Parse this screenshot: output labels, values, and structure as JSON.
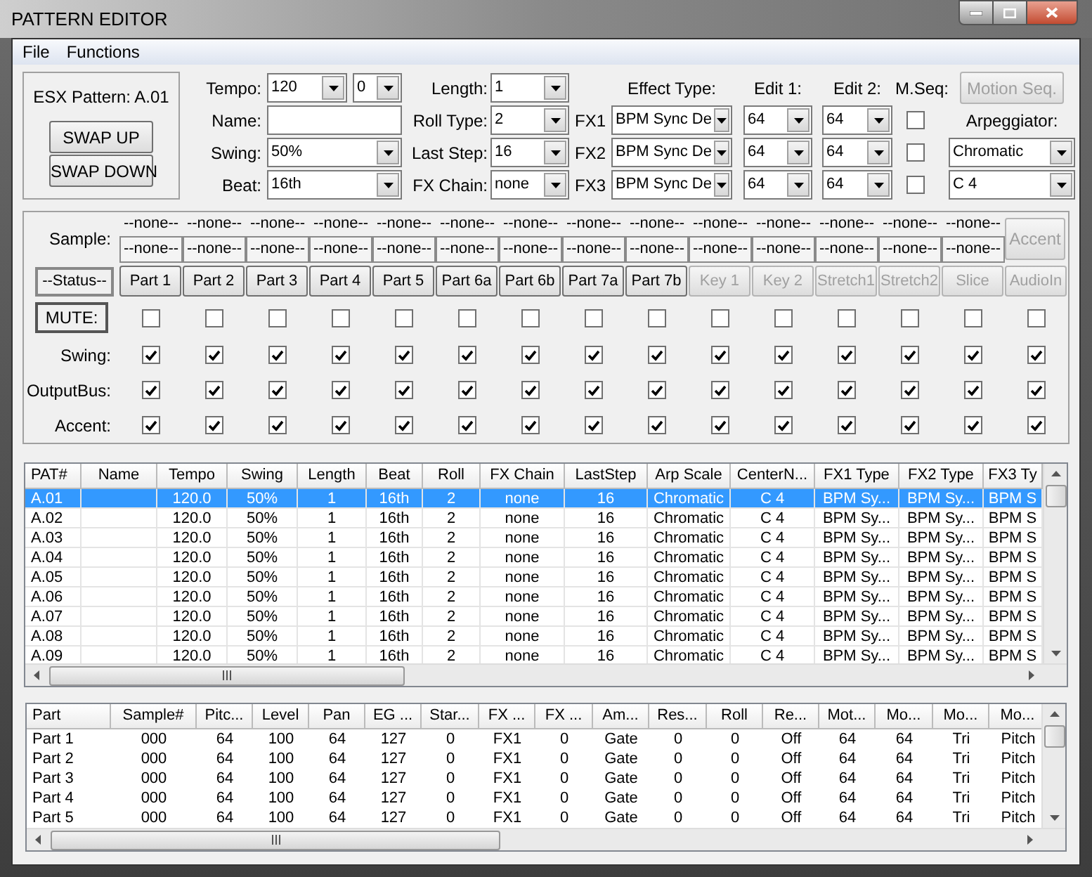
{
  "window": {
    "title": "PATTERN EDITOR"
  },
  "menu": [
    "File",
    "Functions"
  ],
  "pattern_box": {
    "label": "ESX Pattern: A.01",
    "buttons": [
      "SWAP UP",
      "SWAP DOWN"
    ]
  },
  "left_fields": [
    {
      "label": "Tempo:",
      "controls": [
        {
          "kind": "combo",
          "value": "120"
        },
        {
          "kind": "combo",
          "value": "0"
        }
      ]
    },
    {
      "label": "Name:",
      "controls": [
        {
          "kind": "text"
        }
      ]
    },
    {
      "label": "Swing:",
      "controls": [
        {
          "kind": "combo",
          "value": "50%"
        }
      ]
    },
    {
      "label": "Beat:",
      "controls": [
        {
          "kind": "combo",
          "value": "16th"
        }
      ]
    }
  ],
  "middle_fields": [
    {
      "label": "Length:",
      "value": "1"
    },
    {
      "label": "Roll Type:",
      "value": "2"
    },
    {
      "label": "Last Step:",
      "value": "16"
    },
    {
      "label": "FX Chain:",
      "value": "none"
    }
  ],
  "effects": {
    "headers": [
      "Effect Type:",
      "Edit 1:",
      "Edit 2:",
      "M.Seq:"
    ],
    "rows": [
      {
        "label": "FX1",
        "type": "BPM Sync De",
        "edit_1": "64",
        "edit_2": "64",
        "m_seq": false
      },
      {
        "label": "FX2",
        "type": "BPM Sync De",
        "edit_1": "64",
        "edit_2": "64",
        "m_seq": false
      },
      {
        "label": "FX3",
        "type": "BPM Sync De",
        "edit_1": "64",
        "edit_2": "64",
        "m_seq": false
      }
    ]
  },
  "motion_seq_button": {
    "label": "Motion Seq.",
    "disabled": true
  },
  "arpeggiator": {
    "label": "Arpeggiator:",
    "scale": "Chromatic",
    "center_note": "C 4"
  },
  "parts_panel": {
    "sample_label": "Sample:",
    "status_button": "--Status--",
    "mute_button": "MUTE:",
    "row_labels": [
      "Swing:",
      "OutputBus:",
      "Accent:"
    ],
    "accent_button": {
      "label": "Accent",
      "disabled": true
    },
    "parts": [
      {
        "name": "Part 1",
        "disabled": false,
        "sample_top": "--none--",
        "sample": "--none--",
        "mute": false,
        "swing": true,
        "output_bus": true,
        "accent": true
      },
      {
        "name": "Part 2",
        "disabled": false,
        "sample_top": "--none--",
        "sample": "--none--",
        "mute": false,
        "swing": true,
        "output_bus": true,
        "accent": true
      },
      {
        "name": "Part 3",
        "disabled": false,
        "sample_top": "--none--",
        "sample": "--none--",
        "mute": false,
        "swing": true,
        "output_bus": true,
        "accent": true
      },
      {
        "name": "Part 4",
        "disabled": false,
        "sample_top": "--none--",
        "sample": "--none--",
        "mute": false,
        "swing": true,
        "output_bus": true,
        "accent": true
      },
      {
        "name": "Part 5",
        "disabled": false,
        "sample_top": "--none--",
        "sample": "--none--",
        "mute": false,
        "swing": true,
        "output_bus": true,
        "accent": true
      },
      {
        "name": "Part 6a",
        "disabled": false,
        "sample_top": "--none--",
        "sample": "--none--",
        "mute": false,
        "swing": true,
        "output_bus": true,
        "accent": true
      },
      {
        "name": "Part 6b",
        "disabled": false,
        "sample_top": "--none--",
        "sample": "--none--",
        "mute": false,
        "swing": true,
        "output_bus": true,
        "accent": true
      },
      {
        "name": "Part 7a",
        "disabled": false,
        "sample_top": "--none--",
        "sample": "--none--",
        "mute": false,
        "swing": true,
        "output_bus": true,
        "accent": true
      },
      {
        "name": "Part 7b",
        "disabled": false,
        "sample_top": "--none--",
        "sample": "--none--",
        "mute": false,
        "swing": true,
        "output_bus": true,
        "accent": true
      },
      {
        "name": "Key 1",
        "disabled": true,
        "sample_top": "--none--",
        "sample": "--none--",
        "mute": false,
        "swing": true,
        "output_bus": true,
        "accent": true
      },
      {
        "name": "Key 2",
        "disabled": true,
        "sample_top": "--none--",
        "sample": "--none--",
        "mute": false,
        "swing": true,
        "output_bus": true,
        "accent": true
      },
      {
        "name": "Stretch1",
        "disabled": true,
        "sample_top": "--none--",
        "sample": "--none--",
        "mute": false,
        "swing": true,
        "output_bus": true,
        "accent": true
      },
      {
        "name": "Stretch2",
        "disabled": true,
        "sample_top": "--none--",
        "sample": "--none--",
        "mute": false,
        "swing": true,
        "output_bus": true,
        "accent": true
      },
      {
        "name": "Slice",
        "disabled": true,
        "sample_top": "--none--",
        "sample": "--none--",
        "mute": false,
        "swing": true,
        "output_bus": true,
        "accent": true
      },
      {
        "name": "AudioIn",
        "disabled": true,
        "mute": false,
        "swing": true,
        "output_bus": true,
        "accent": true
      }
    ]
  },
  "patterns_table": {
    "columns": [
      "PAT#",
      "Name",
      "Tempo",
      "Swing",
      "Length",
      "Beat",
      "Roll",
      "FX Chain",
      "LastStep",
      "Arp Scale",
      "CenterN...",
      "FX1 Type",
      "FX2 Type",
      "FX3 Ty"
    ],
    "rows": [
      {
        "selected": true,
        "cells": [
          "A.01",
          "",
          "120.0",
          "50%",
          "1",
          "16th",
          "2",
          "none",
          "16",
          "Chromatic",
          "C 4",
          "BPM Sy...",
          "BPM Sy...",
          "BPM S"
        ]
      },
      {
        "selected": false,
        "cells": [
          "A.02",
          "",
          "120.0",
          "50%",
          "1",
          "16th",
          "2",
          "none",
          "16",
          "Chromatic",
          "C 4",
          "BPM Sy...",
          "BPM Sy...",
          "BPM S"
        ]
      },
      {
        "selected": false,
        "cells": [
          "A.03",
          "",
          "120.0",
          "50%",
          "1",
          "16th",
          "2",
          "none",
          "16",
          "Chromatic",
          "C 4",
          "BPM Sy...",
          "BPM Sy...",
          "BPM S"
        ]
      },
      {
        "selected": false,
        "cells": [
          "A.04",
          "",
          "120.0",
          "50%",
          "1",
          "16th",
          "2",
          "none",
          "16",
          "Chromatic",
          "C 4",
          "BPM Sy...",
          "BPM Sy...",
          "BPM S"
        ]
      },
      {
        "selected": false,
        "cells": [
          "A.05",
          "",
          "120.0",
          "50%",
          "1",
          "16th",
          "2",
          "none",
          "16",
          "Chromatic",
          "C 4",
          "BPM Sy...",
          "BPM Sy...",
          "BPM S"
        ]
      },
      {
        "selected": false,
        "cells": [
          "A.06",
          "",
          "120.0",
          "50%",
          "1",
          "16th",
          "2",
          "none",
          "16",
          "Chromatic",
          "C 4",
          "BPM Sy...",
          "BPM Sy...",
          "BPM S"
        ]
      },
      {
        "selected": false,
        "cells": [
          "A.07",
          "",
          "120.0",
          "50%",
          "1",
          "16th",
          "2",
          "none",
          "16",
          "Chromatic",
          "C 4",
          "BPM Sy...",
          "BPM Sy...",
          "BPM S"
        ]
      },
      {
        "selected": false,
        "cells": [
          "A.08",
          "",
          "120.0",
          "50%",
          "1",
          "16th",
          "2",
          "none",
          "16",
          "Chromatic",
          "C 4",
          "BPM Sy...",
          "BPM Sy...",
          "BPM S"
        ]
      },
      {
        "selected": false,
        "cells": [
          "A.09",
          "",
          "120.0",
          "50%",
          "1",
          "16th",
          "2",
          "none",
          "16",
          "Chromatic",
          "C 4",
          "BPM Sy...",
          "BPM Sy...",
          "BPM S"
        ]
      }
    ]
  },
  "parts_table": {
    "columns": [
      "Part",
      "Sample#",
      "Pitc...",
      "Level",
      "Pan",
      "EG ...",
      "Star...",
      "FX ...",
      "FX ...",
      "Am...",
      "Res...",
      "Roll",
      "Re...",
      "Mot...",
      "Mo...",
      "Mo...",
      "Mo..."
    ],
    "rows": [
      [
        "Part 1",
        "000",
        "64",
        "100",
        "64",
        "127",
        "0",
        "FX1",
        "0",
        "Gate",
        "0",
        "0",
        "Off",
        "64",
        "64",
        "Tri",
        "Pitch"
      ],
      [
        "Part 2",
        "000",
        "64",
        "100",
        "64",
        "127",
        "0",
        "FX1",
        "0",
        "Gate",
        "0",
        "0",
        "Off",
        "64",
        "64",
        "Tri",
        "Pitch"
      ],
      [
        "Part 3",
        "000",
        "64",
        "100",
        "64",
        "127",
        "0",
        "FX1",
        "0",
        "Gate",
        "0",
        "0",
        "Off",
        "64",
        "64",
        "Tri",
        "Pitch"
      ],
      [
        "Part 4",
        "000",
        "64",
        "100",
        "64",
        "127",
        "0",
        "FX1",
        "0",
        "Gate",
        "0",
        "0",
        "Off",
        "64",
        "64",
        "Tri",
        "Pitch"
      ],
      [
        "Part 5",
        "000",
        "64",
        "100",
        "64",
        "127",
        "0",
        "FX1",
        "0",
        "Gate",
        "0",
        "0",
        "Off",
        "64",
        "64",
        "Tri",
        "Pitch"
      ]
    ]
  }
}
